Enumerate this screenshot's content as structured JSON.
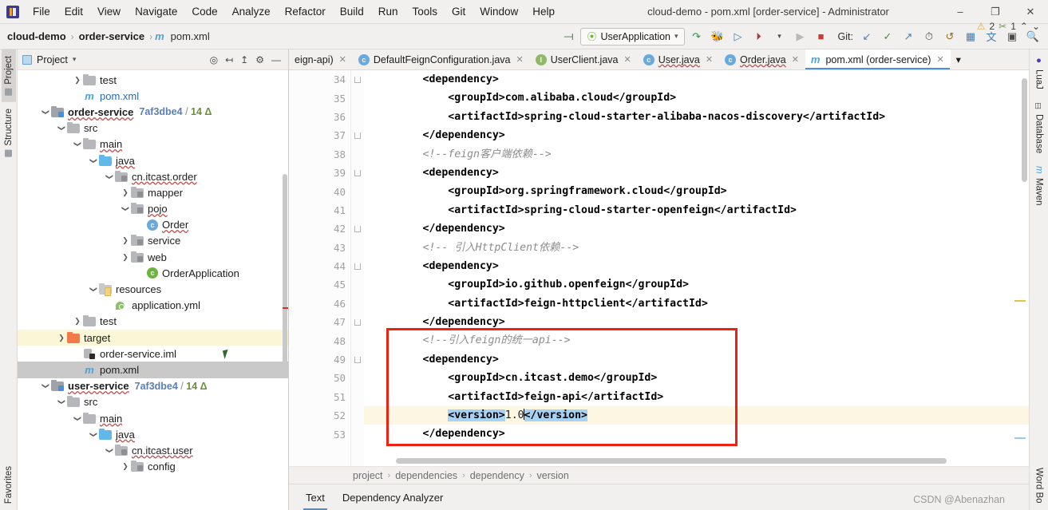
{
  "window": {
    "title": "cloud-demo - pom.xml [order-service] - Administrator",
    "minimize": "–",
    "maximize": "❐",
    "close": "✕"
  },
  "menubar": {
    "items": [
      "File",
      "Edit",
      "View",
      "Navigate",
      "Code",
      "Analyze",
      "Refactor",
      "Build",
      "Run",
      "Tools",
      "Git",
      "Window",
      "Help"
    ]
  },
  "navbar": {
    "breadcrumbs": [
      "cloud-demo",
      "order-service",
      "pom.xml"
    ],
    "maven_icon": "m",
    "separator": "›",
    "run_config": "UserApplication",
    "run_config_caret": "▾",
    "git_label": "Git:",
    "icons": [
      "build-icon",
      "debug-icon",
      "run-with-coverage-icon",
      "profiler-icon",
      "run-icon",
      "stop-icon",
      "update-project-icon",
      "commit-icon",
      "push-icon",
      "history-icon",
      "rollback-icon",
      "problems-icon",
      "translate-icon",
      "layout-icon",
      "search-everywhere-icon"
    ]
  },
  "left_strip": {
    "tabs": [
      "Project",
      "Structure"
    ],
    "bottom_tab": "Favorites"
  },
  "right_strip": {
    "tabs": [
      "LuaJ",
      "Database",
      "Maven",
      "Word Bo"
    ]
  },
  "project_panel": {
    "title": "Project",
    "caret": "▾",
    "header_icons": [
      "locate-icon",
      "expand-all-icon",
      "collapse-all-icon",
      "settings-gear-icon",
      "hide-icon"
    ],
    "tree": [
      {
        "indent": 3,
        "arrow": "right",
        "icon": "folder",
        "label": "test",
        "meta": "",
        "state": "",
        "style": ""
      },
      {
        "indent": 3,
        "arrow": "none",
        "icon": "maven",
        "label": "pom.xml",
        "meta": "",
        "state": "",
        "style": "blue"
      },
      {
        "indent": 1,
        "arrow": "down",
        "icon": "module",
        "label": "order-service",
        "meta": "7af3dbe4 / 14",
        "state": "",
        "style": "bold-squig"
      },
      {
        "indent": 2,
        "arrow": "down",
        "icon": "folder",
        "label": "src",
        "meta": "",
        "state": "",
        "style": ""
      },
      {
        "indent": 3,
        "arrow": "down",
        "icon": "folder",
        "label": "main",
        "meta": "",
        "state": "",
        "style": "squig"
      },
      {
        "indent": 4,
        "arrow": "down",
        "icon": "folder-blue",
        "label": "java",
        "meta": "",
        "state": "",
        "style": "squig"
      },
      {
        "indent": 5,
        "arrow": "down",
        "icon": "package",
        "label": "cn.itcast.order",
        "meta": "",
        "state": "",
        "style": "squig"
      },
      {
        "indent": 6,
        "arrow": "right",
        "icon": "package",
        "label": "mapper",
        "meta": "",
        "state": "",
        "style": ""
      },
      {
        "indent": 6,
        "arrow": "down",
        "icon": "package",
        "label": "pojo",
        "meta": "",
        "state": "",
        "style": "squig"
      },
      {
        "indent": 7,
        "arrow": "none",
        "icon": "class",
        "label": "Order",
        "meta": "",
        "state": "",
        "style": "squig"
      },
      {
        "indent": 6,
        "arrow": "right",
        "icon": "package",
        "label": "service",
        "meta": "",
        "state": "",
        "style": ""
      },
      {
        "indent": 6,
        "arrow": "right",
        "icon": "package",
        "label": "web",
        "meta": "",
        "state": "",
        "style": ""
      },
      {
        "indent": 7,
        "arrow": "none",
        "icon": "class-spring",
        "label": "OrderApplication",
        "meta": "",
        "state": "",
        "style": ""
      },
      {
        "indent": 4,
        "arrow": "down",
        "icon": "folder-res",
        "label": "resources",
        "meta": "",
        "state": "",
        "style": ""
      },
      {
        "indent": 5,
        "arrow": "none",
        "icon": "yml",
        "label": "application.yml",
        "meta": "",
        "state": "",
        "style": ""
      },
      {
        "indent": 3,
        "arrow": "right",
        "icon": "folder",
        "label": "test",
        "meta": "",
        "state": "",
        "style": ""
      },
      {
        "indent": 2,
        "arrow": "right",
        "icon": "folder-orange",
        "label": "target",
        "meta": "",
        "state": "yellow",
        "style": ""
      },
      {
        "indent": 3,
        "arrow": "none",
        "icon": "iml",
        "label": "order-service.iml",
        "meta": "",
        "state": "",
        "style": ""
      },
      {
        "indent": 3,
        "arrow": "none",
        "icon": "maven",
        "label": "pom.xml",
        "meta": "",
        "state": "selected",
        "style": ""
      },
      {
        "indent": 1,
        "arrow": "down",
        "icon": "module",
        "label": "user-service",
        "meta": "7af3dbe4 / 14",
        "state": "",
        "style": "bold-squig"
      },
      {
        "indent": 2,
        "arrow": "down",
        "icon": "folder",
        "label": "src",
        "meta": "",
        "state": "",
        "style": ""
      },
      {
        "indent": 3,
        "arrow": "down",
        "icon": "folder",
        "label": "main",
        "meta": "",
        "state": "",
        "style": "squig"
      },
      {
        "indent": 4,
        "arrow": "down",
        "icon": "folder-blue",
        "label": "java",
        "meta": "",
        "state": "",
        "style": "squig"
      },
      {
        "indent": 5,
        "arrow": "down",
        "icon": "package",
        "label": "cn.itcast.user",
        "meta": "",
        "state": "",
        "style": "squig"
      },
      {
        "indent": 6,
        "arrow": "right",
        "icon": "package",
        "label": "config",
        "meta": "",
        "state": "",
        "style": ""
      }
    ]
  },
  "editor": {
    "tabs": [
      {
        "label": "eign-api)",
        "icon": "none",
        "active": false,
        "close": "✕",
        "squiggle": false
      },
      {
        "label": "DefaultFeignConfiguration.java",
        "icon": "class",
        "active": false,
        "close": "✕",
        "squiggle": false
      },
      {
        "label": "UserClient.java",
        "icon": "interface",
        "active": false,
        "close": "✕",
        "squiggle": false
      },
      {
        "label": "User.java",
        "icon": "class",
        "active": false,
        "close": "✕",
        "squiggle": true
      },
      {
        "label": "Order.java",
        "icon": "class",
        "active": false,
        "close": "✕",
        "squiggle": true
      },
      {
        "label": "pom.xml (order-service)",
        "icon": "maven",
        "active": true,
        "close": "✕",
        "squiggle": false
      }
    ],
    "tabs_overflow": "▾",
    "inspection": {
      "warning_icon": "⚠",
      "warning_count": "2",
      "weak_warning_icon": "✂",
      "weak_warning_count": "1",
      "up": "⌃",
      "down": "⌄"
    },
    "first_line_number": 34,
    "lines": [
      {
        "n": 34,
        "indent": 8,
        "runmark": true,
        "fold": true,
        "html": "&lt;dependency&gt;",
        "kind": "tag",
        "highlight": false
      },
      {
        "n": 35,
        "indent": 12,
        "runmark": false,
        "fold": false,
        "html": "&lt;groupId&gt;com.alibaba.cloud&lt;/groupId&gt;",
        "kind": "tag",
        "highlight": false
      },
      {
        "n": 36,
        "indent": 12,
        "runmark": false,
        "fold": false,
        "html": "&lt;artifactId&gt;spring-cloud-starter-alibaba-nacos-discovery&lt;/artifactId&gt;",
        "kind": "tag",
        "highlight": false
      },
      {
        "n": 37,
        "indent": 8,
        "runmark": false,
        "fold": true,
        "html": "&lt;/dependency&gt;",
        "kind": "tag",
        "highlight": false
      },
      {
        "n": 38,
        "indent": 8,
        "runmark": false,
        "fold": false,
        "html": "&lt;!--feign客户端依赖--&gt;",
        "kind": "comment",
        "highlight": false
      },
      {
        "n": 39,
        "indent": 8,
        "runmark": true,
        "fold": true,
        "html": "&lt;dependency&gt;",
        "kind": "tag",
        "highlight": false
      },
      {
        "n": 40,
        "indent": 12,
        "runmark": false,
        "fold": false,
        "html": "&lt;groupId&gt;org.springframework.cloud&lt;/groupId&gt;",
        "kind": "tag",
        "highlight": false
      },
      {
        "n": 41,
        "indent": 12,
        "runmark": false,
        "fold": false,
        "html": "&lt;artifactId&gt;spring-cloud-starter-openfeign&lt;/artifactId&gt;",
        "kind": "tag",
        "highlight": false
      },
      {
        "n": 42,
        "indent": 8,
        "runmark": false,
        "fold": true,
        "html": "&lt;/dependency&gt;",
        "kind": "tag",
        "highlight": false
      },
      {
        "n": 43,
        "indent": 8,
        "runmark": false,
        "fold": false,
        "html": "&lt;!-- 引入HttpClient依赖--&gt;",
        "kind": "comment",
        "highlight": false
      },
      {
        "n": 44,
        "indent": 8,
        "runmark": true,
        "fold": true,
        "html": "&lt;dependency&gt;",
        "kind": "tag",
        "highlight": false
      },
      {
        "n": 45,
        "indent": 12,
        "runmark": false,
        "fold": false,
        "html": "&lt;groupId&gt;io.github.openfeign&lt;/groupId&gt;",
        "kind": "tag",
        "highlight": false
      },
      {
        "n": 46,
        "indent": 12,
        "runmark": false,
        "fold": false,
        "html": "&lt;artifactId&gt;feign-httpclient&lt;/artifactId&gt;",
        "kind": "tag",
        "highlight": false
      },
      {
        "n": 47,
        "indent": 8,
        "runmark": false,
        "fold": true,
        "html": "&lt;/dependency&gt;",
        "kind": "tag",
        "highlight": false
      },
      {
        "n": 48,
        "indent": 8,
        "runmark": false,
        "fold": false,
        "html": "&lt;!--引入feign的统一api--&gt;",
        "kind": "comment",
        "highlight": false
      },
      {
        "n": 49,
        "indent": 8,
        "runmark": false,
        "fold": true,
        "html": "&lt;dependency&gt;",
        "kind": "tag",
        "highlight": false
      },
      {
        "n": 50,
        "indent": 12,
        "runmark": false,
        "fold": false,
        "html": "&lt;groupId&gt;cn.itcast.demo&lt;/groupId&gt;",
        "kind": "tag",
        "highlight": false
      },
      {
        "n": 51,
        "indent": 12,
        "runmark": false,
        "fold": false,
        "html": "&lt;artifactId&gt;feign-api&lt;/artifactId&gt;",
        "kind": "tag",
        "highlight": false
      },
      {
        "n": 52,
        "indent": 12,
        "runmark": false,
        "fold": false,
        "html": "VERSION_LINE",
        "kind": "selection",
        "highlight": true
      },
      {
        "n": 53,
        "indent": 8,
        "runmark": false,
        "fold": false,
        "html": "&lt;/dependency&gt;",
        "kind": "tag",
        "highlight": false
      }
    ],
    "version_line": {
      "open_tag": "<version>",
      "value": "1.0",
      "close_tag": "</version>"
    },
    "breadcrumb": [
      "project",
      "dependencies",
      "dependency",
      "version"
    ],
    "breadcrumb_sep": "›",
    "bottom_tabs": [
      {
        "label": "Text",
        "active": true
      },
      {
        "label": "Dependency Analyzer",
        "active": false
      }
    ]
  },
  "watermark": "CSDN @Abenazhan",
  "colors": {
    "accent_blue": "#4a90d9",
    "selection_blue": "#a6d2f5",
    "highlight_line": "#fdf6e3",
    "red_box": "#ee2211",
    "tree_selected": "#c9c9c9",
    "tree_yellow": "#fbf7d6"
  }
}
